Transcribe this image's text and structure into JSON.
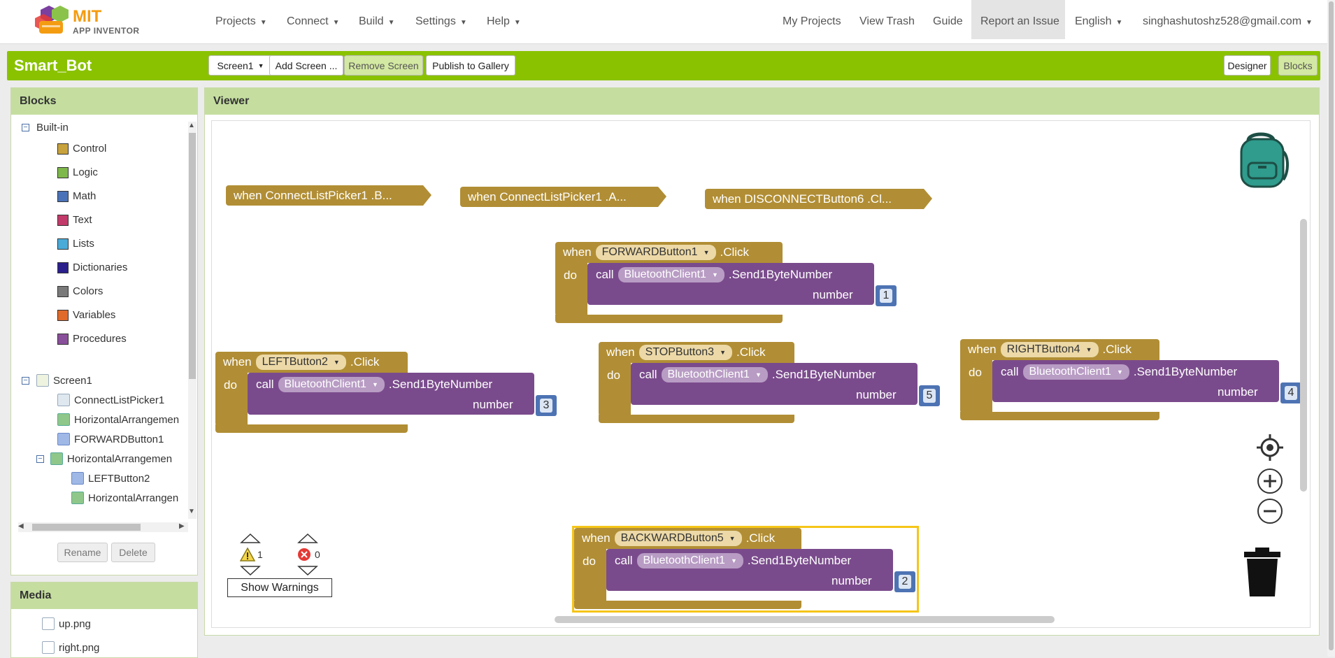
{
  "brand": {
    "line1": "MIT",
    "line2": "APP INVENTOR"
  },
  "nav": {
    "projects": "Projects",
    "connect": "Connect",
    "build": "Build",
    "settings": "Settings",
    "help": "Help",
    "my_projects": "My Projects",
    "view_trash": "View Trash",
    "guide": "Guide",
    "report": "Report an Issue",
    "language": "English",
    "account": "singhashutoshz528@gmail.com"
  },
  "project": {
    "name": "Smart_Bot",
    "screen_select": "Screen1",
    "add_screen": "Add Screen ...",
    "remove_screen": "Remove Screen",
    "publish": "Publish to Gallery",
    "designer": "Designer",
    "blocks": "Blocks"
  },
  "blocks_panel": {
    "title": "Blocks",
    "builtin": "Built-in",
    "categories": [
      {
        "label": "Control",
        "color": "#c8a23c"
      },
      {
        "label": "Logic",
        "color": "#7fb84a"
      },
      {
        "label": "Math",
        "color": "#4a72b8"
      },
      {
        "label": "Text",
        "color": "#c23a6a"
      },
      {
        "label": "Lists",
        "color": "#4aaad8"
      },
      {
        "label": "Dictionaries",
        "color": "#2b1f8c"
      },
      {
        "label": "Colors",
        "color": "#7a7a7a"
      },
      {
        "label": "Variables",
        "color": "#e06a2a"
      },
      {
        "label": "Procedures",
        "color": "#8a4f9a"
      }
    ],
    "components": [
      "Screen1",
      "ConnectListPicker1",
      "HorizontalArrangemen",
      "FORWARDButton1",
      "HorizontalArrangemen",
      "LEFTButton2",
      "HorizontalArrangen"
    ],
    "rename": "Rename",
    "delete": "Delete"
  },
  "media": {
    "title": "Media",
    "files": [
      "up.png",
      "right.png"
    ]
  },
  "viewer": {
    "title": "Viewer",
    "collapsed": [
      "when  ConnectListPicker1 .B...",
      "when  ConnectListPicker1 .A...",
      "when  DISCONNECTButton6 .Cl..."
    ],
    "handlers": [
      {
        "component": "FORWARDButton1",
        "number": "1"
      },
      {
        "component": "LEFTButton2",
        "number": "3"
      },
      {
        "component": "STOPButton3",
        "number": "5"
      },
      {
        "component": "RIGHTButton4",
        "number": "4"
      },
      {
        "component": "BACKWARDButton5",
        "number": "2"
      }
    ],
    "kw_when": "when",
    "kw_do": "do",
    "kw_call": "call",
    "event": ".Click",
    "client": "BluetoothClient1",
    "method": ".Send1ByteNumber",
    "arg": "number",
    "warnings_count": "1",
    "errors_count": "0",
    "show_warnings": "Show Warnings"
  }
}
